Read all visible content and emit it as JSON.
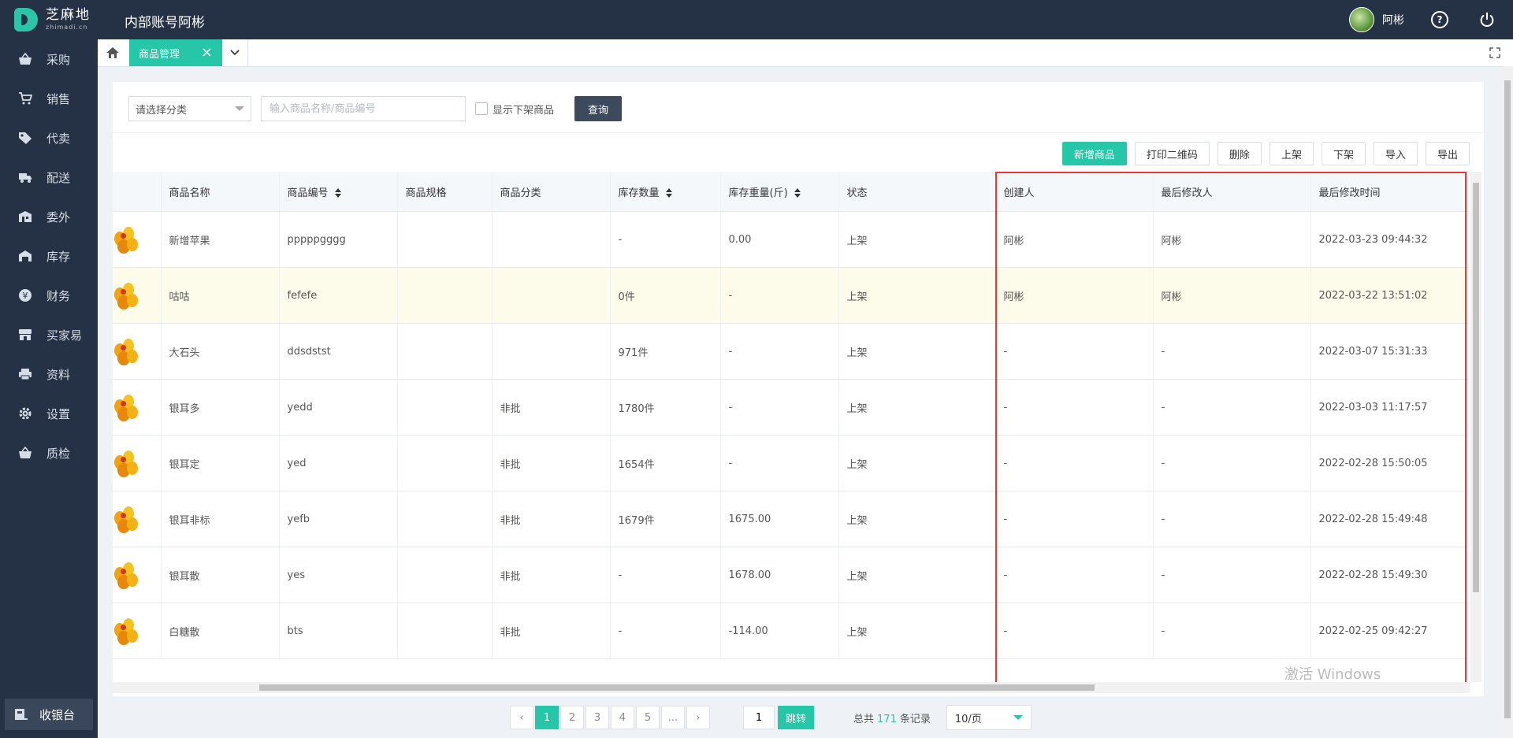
{
  "app": {
    "logo_cn": "芝麻地",
    "logo_en": "zhimadi.cn",
    "title": "内部账号阿彬",
    "user_name": "阿彬"
  },
  "sidebar": {
    "items": [
      {
        "label": "采购",
        "icon": "basket-icon"
      },
      {
        "label": "销售",
        "icon": "cart-icon"
      },
      {
        "label": "代卖",
        "icon": "tag-icon"
      },
      {
        "label": "配送",
        "icon": "truck-icon"
      },
      {
        "label": "委外",
        "icon": "building-icon"
      },
      {
        "label": "库存",
        "icon": "warehouse-icon"
      },
      {
        "label": "财务",
        "icon": "yen-icon"
      },
      {
        "label": "买家易",
        "icon": "store-icon"
      },
      {
        "label": "资料",
        "icon": "printer-icon"
      },
      {
        "label": "设置",
        "icon": "gear-icon"
      },
      {
        "label": "质检",
        "icon": "basket-icon"
      }
    ],
    "cashier_label": "收银台"
  },
  "tabs": {
    "active_label": "商品管理"
  },
  "filters": {
    "category_placeholder": "请选择分类",
    "search_placeholder": "输入商品名称/商品编号",
    "show_offshelf_label": "显示下架商品",
    "query_label": "查询"
  },
  "actions": {
    "add": "新增商品",
    "print_qr": "打印二维码",
    "delete": "删除",
    "on_shelf": "上架",
    "off_shelf": "下架",
    "import": "导入",
    "export": "导出"
  },
  "table": {
    "headers": {
      "name": "商品名称",
      "code": "商品编号",
      "spec": "商品规格",
      "category": "商品分类",
      "stock_qty": "库存数量",
      "stock_weight": "库存重量(斤)",
      "status": "状态",
      "creator": "创建人",
      "modifier": "最后修改人",
      "modified_time": "最后修改时间"
    },
    "rows": [
      {
        "name": "新增苹果",
        "code": "pppppgggg",
        "spec": "",
        "category": "",
        "stock_qty": "-",
        "stock_weight": "0.00",
        "status": "上架",
        "creator": "阿彬",
        "modifier": "阿彬",
        "modified_time": "2022-03-23 09:44:32"
      },
      {
        "name": "咕咕",
        "code": "fefefe",
        "spec": "",
        "category": "",
        "stock_qty": "0件",
        "stock_weight": "-",
        "status": "上架",
        "creator": "阿彬",
        "modifier": "阿彬",
        "modified_time": "2022-03-22 13:51:02"
      },
      {
        "name": "大石头",
        "code": "ddsdstst",
        "spec": "",
        "category": "",
        "stock_qty": "971件",
        "stock_weight": "-",
        "status": "上架",
        "creator": "-",
        "modifier": "-",
        "modified_time": "2022-03-07 15:31:33"
      },
      {
        "name": "银耳多",
        "code": "yedd",
        "spec": "",
        "category": "非批",
        "stock_qty": "1780件",
        "stock_weight": "-",
        "status": "上架",
        "creator": "-",
        "modifier": "-",
        "modified_time": "2022-03-03 11:17:57"
      },
      {
        "name": "银耳定",
        "code": "yed",
        "spec": "",
        "category": "非批",
        "stock_qty": "1654件",
        "stock_weight": "-",
        "status": "上架",
        "creator": "-",
        "modifier": "-",
        "modified_time": "2022-02-28 15:50:05"
      },
      {
        "name": "银耳非标",
        "code": "yefb",
        "spec": "",
        "category": "非批",
        "stock_qty": "1679件",
        "stock_weight": "1675.00",
        "status": "上架",
        "creator": "-",
        "modifier": "-",
        "modified_time": "2022-02-28 15:49:48"
      },
      {
        "name": "银耳散",
        "code": "yes",
        "spec": "",
        "category": "非批",
        "stock_qty": "-",
        "stock_weight": "1678.00",
        "status": "上架",
        "creator": "-",
        "modifier": "-",
        "modified_time": "2022-02-28 15:49:30"
      },
      {
        "name": "白糖散",
        "code": "bts",
        "spec": "",
        "category": "非批",
        "stock_qty": "-",
        "stock_weight": "-114.00",
        "status": "上架",
        "creator": "-",
        "modifier": "-",
        "modified_time": "2022-02-25 09:42:27"
      }
    ]
  },
  "pagination": {
    "pages": [
      "1",
      "2",
      "3",
      "4",
      "5",
      "..."
    ],
    "goto_value": "1",
    "goto_label": "跳转",
    "total_prefix": "总共",
    "total_count": "171",
    "total_suffix": "条记录",
    "page_size": "10/页"
  },
  "watermark": "激活 Windows",
  "colors": {
    "accent": "#26c6a8",
    "sidebar": "#253144",
    "highlight_box": "#e53935"
  }
}
